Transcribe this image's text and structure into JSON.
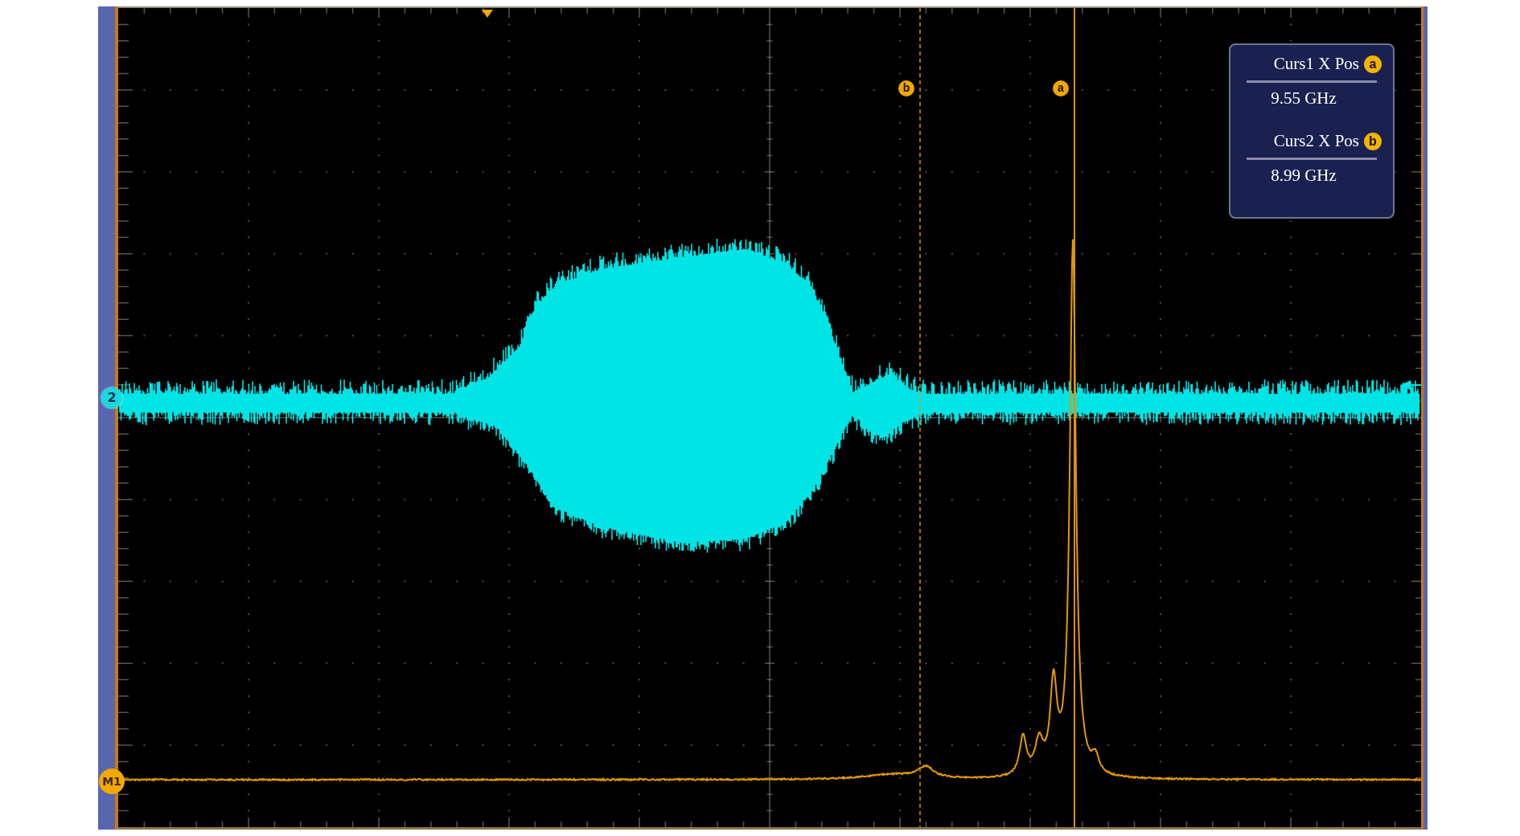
{
  "channel_markers": [
    {
      "label": "2",
      "kind": "channel"
    },
    {
      "label": "M1",
      "kind": "math"
    }
  ],
  "cursor_markers": [
    {
      "label": "b",
      "kind": "dashed"
    },
    {
      "label": "a",
      "kind": "solid"
    }
  ],
  "readouts": [
    {
      "label": "Curs1 X Pos",
      "badge": "a",
      "value": "9.55 GHz"
    },
    {
      "label": "Curs2 X Pos",
      "badge": "b",
      "value": "8.99 GHz"
    }
  ]
}
